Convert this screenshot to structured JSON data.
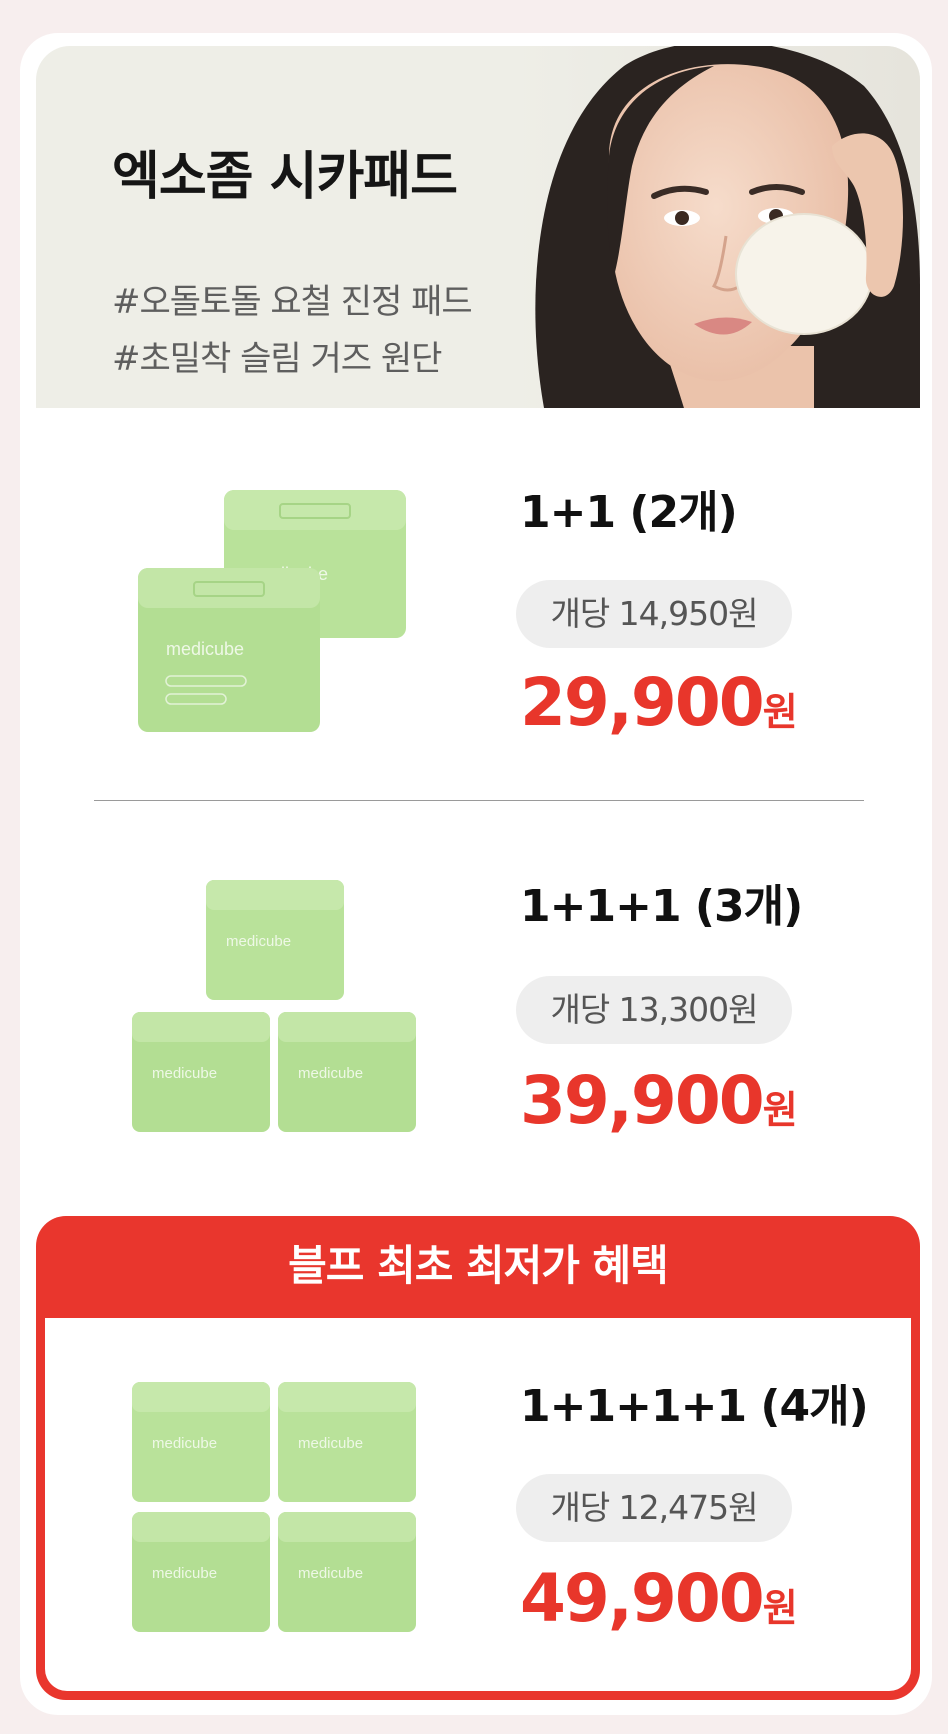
{
  "hero": {
    "title": "엑소좀 시카패드",
    "tags": [
      "#오돌토돌 요철 진정 패드",
      "#초밀착 슬림 거즈 원단"
    ]
  },
  "products": [
    {
      "name": "1+1 (2개)",
      "unit_price": "개당 14,950원",
      "price": "29,900",
      "currency": "원"
    },
    {
      "name": "1+1+1 (3개)",
      "unit_price": "개당 13,300원",
      "price": "39,900",
      "currency": "원"
    },
    {
      "name": "1+1+1+1 (4개)",
      "unit_price": "개당 12,475원",
      "price": "49,900",
      "currency": "원"
    }
  ],
  "promo": {
    "banner": "블프 최초 최저가 혜택"
  },
  "brand": {
    "jar_label": "medicube"
  },
  "colors": {
    "accent": "#e9362d",
    "jar": "#b9e29a",
    "hero_bg": "#eeeee7"
  }
}
